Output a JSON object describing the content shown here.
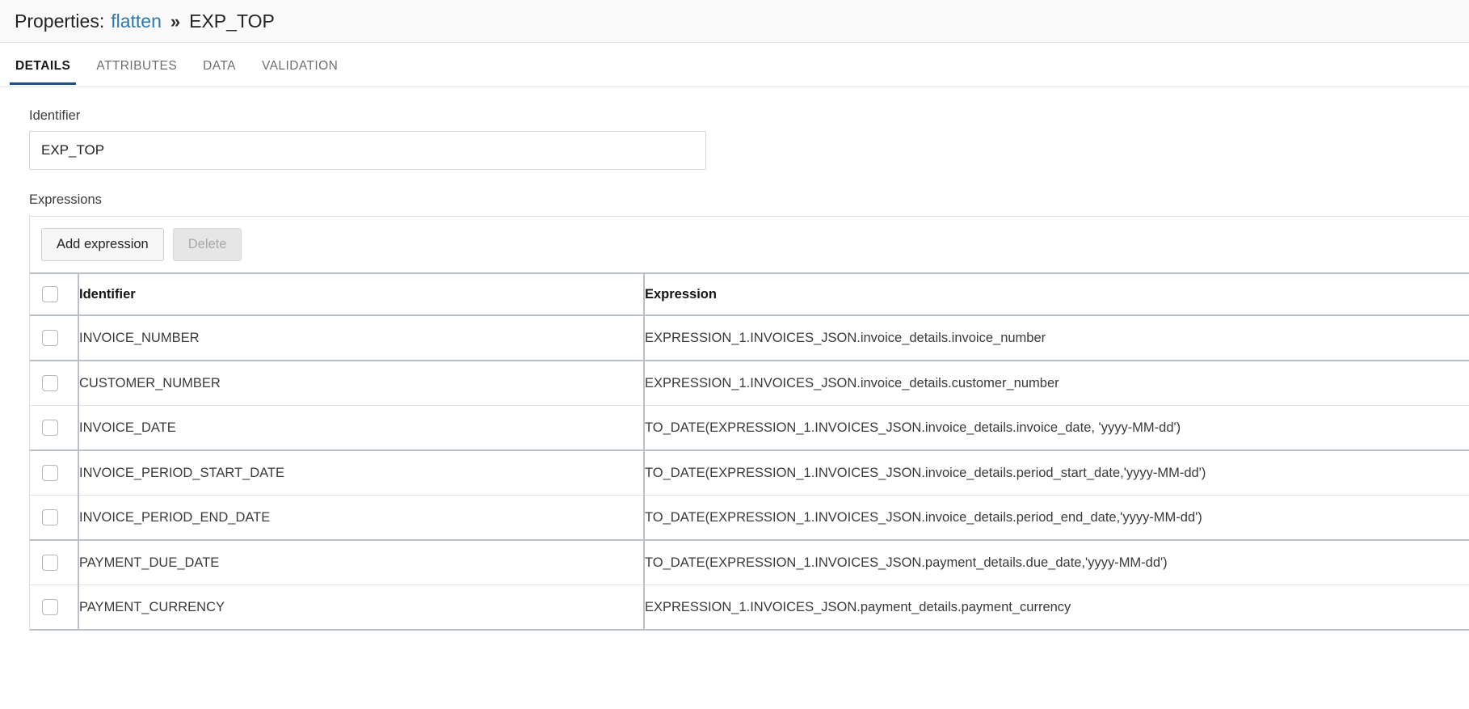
{
  "breadcrumb": {
    "prefix": "Properties:",
    "link": "flatten",
    "separator": "»",
    "current": "EXP_TOP"
  },
  "tabs": [
    {
      "label": "DETAILS",
      "active": true
    },
    {
      "label": "ATTRIBUTES",
      "active": false
    },
    {
      "label": "DATA",
      "active": false
    },
    {
      "label": "VALIDATION",
      "active": false
    }
  ],
  "identifier_field": {
    "label": "Identifier",
    "value": "EXP_TOP",
    "placeholder": ""
  },
  "expressions_section": {
    "label": "Expressions",
    "toolbar": {
      "add_label": "Add expression",
      "delete_label": "Delete"
    },
    "columns": [
      "",
      "Identifier",
      "Expression"
    ],
    "rows": [
      {
        "selected": false,
        "identifier": "INVOICE_NUMBER",
        "expression": "EXPRESSION_1.INVOICES_JSON.invoice_details.invoice_number"
      },
      {
        "selected": false,
        "identifier": "CUSTOMER_NUMBER",
        "expression": "EXPRESSION_1.INVOICES_JSON.invoice_details.customer_number"
      },
      {
        "selected": false,
        "identifier": "INVOICE_DATE",
        "expression": "TO_DATE(EXPRESSION_1.INVOICES_JSON.invoice_details.invoice_date, 'yyyy-MM-dd')"
      },
      {
        "selected": false,
        "identifier": "INVOICE_PERIOD_START_DATE",
        "expression": "TO_DATE(EXPRESSION_1.INVOICES_JSON.invoice_details.period_start_date,'yyyy-MM-dd')"
      },
      {
        "selected": false,
        "identifier": "INVOICE_PERIOD_END_DATE",
        "expression": "TO_DATE(EXPRESSION_1.INVOICES_JSON.invoice_details.period_end_date,'yyyy-MM-dd')"
      },
      {
        "selected": false,
        "identifier": "PAYMENT_DUE_DATE",
        "expression": "TO_DATE(EXPRESSION_1.INVOICES_JSON.payment_details.due_date,'yyyy-MM-dd')"
      },
      {
        "selected": false,
        "identifier": "PAYMENT_CURRENCY",
        "expression": "EXPRESSION_1.INVOICES_JSON.payment_details.payment_currency"
      }
    ]
  },
  "colors": {
    "link": "#2a7ab0",
    "active_tab_underline": "#1b4f8a",
    "table_rule": "#b9c0c8",
    "border": "#dcdcdc"
  }
}
